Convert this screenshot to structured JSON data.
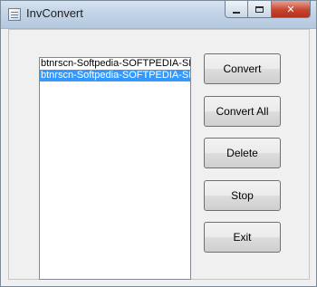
{
  "window": {
    "title": "InvConvert",
    "close_glyph": "✕"
  },
  "list": {
    "items": [
      {
        "label": "btnrscn-Softpedia-SOFTPEDIA-SE",
        "selected": false
      },
      {
        "label": "btnrscn-Softpedia-SOFTPEDIA-SE",
        "selected": true
      }
    ]
  },
  "buttons": {
    "convert": "Convert",
    "convert_all": "Convert All",
    "delete": "Delete",
    "stop": "Stop",
    "exit": "Exit"
  },
  "colors": {
    "selection": "#3399ff",
    "titlebar": "#c2d4e8",
    "close": "#c7452f"
  }
}
